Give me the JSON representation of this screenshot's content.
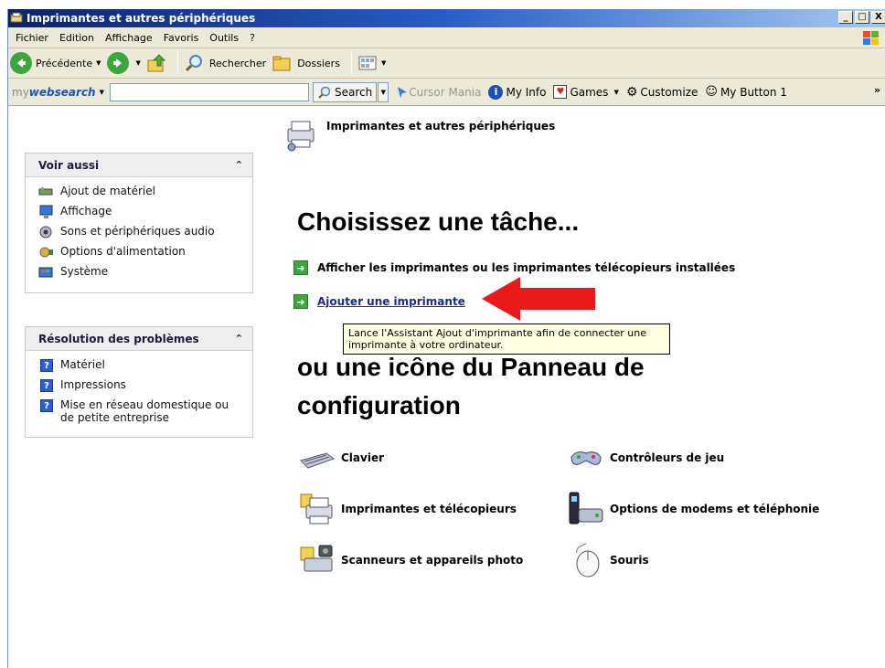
{
  "window": {
    "title": "Imprimantes et autres périphériques"
  },
  "titlebar_buttons": [
    "_",
    "□",
    "X"
  ],
  "menu": [
    "Fichier",
    "Edition",
    "Affichage",
    "Favoris",
    "Outils",
    "?"
  ],
  "toolbar": {
    "back": "Précédente",
    "search": "Rechercher",
    "folders": "Dossiers"
  },
  "websearch": {
    "logo_prefix": "my",
    "logo_brand": "websearch",
    "input_value": "",
    "search_btn": "Search",
    "items": [
      "Cursor Mania",
      "My Info",
      "Games",
      "Customize",
      "My Button 1"
    ]
  },
  "see_also": {
    "title": "Voir aussi",
    "items": [
      "Ajout de matériel",
      "Affichage",
      "Sons et périphériques audio",
      "Options d'alimentation",
      "Système"
    ]
  },
  "troubleshoot": {
    "title": "Résolution des problèmes",
    "items": [
      "Matériel",
      "Impressions",
      "Mise en réseau domestique ou de petite entreprise"
    ]
  },
  "main": {
    "header": "Imprimantes et autres périphériques",
    "task_heading": "Choisissez une tâche...",
    "tasks": [
      "Afficher les imprimantes ou les imprimantes télécopieurs installées",
      "Ajouter une imprimante"
    ],
    "tooltip": "Lance l'Assistant Ajout d'imprimante afin de connecter une imprimante à votre ordinateur.",
    "or_heading_line1": "ou une icône du Panneau de",
    "or_heading_line2": "configuration",
    "icons": [
      "Clavier",
      "Contrôleurs de jeu",
      "Imprimantes et télécopieurs",
      "Options de modems et téléphonie",
      "Scanneurs et appareils photo",
      "Souris"
    ]
  },
  "colors": {
    "titlebar": "#0a246a",
    "link": "#1c2b8c",
    "arrow": "#e81a1a",
    "tooltip_bg": "#ffffe1"
  }
}
